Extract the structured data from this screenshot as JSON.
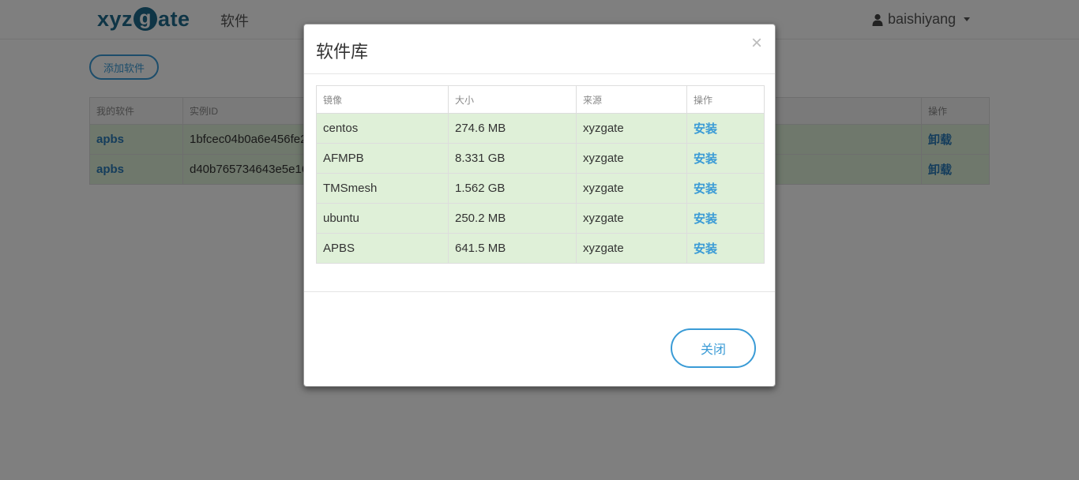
{
  "navbar": {
    "logo_prefix": "xyz",
    "logo_g": "g",
    "logo_suffix": "ate",
    "nav_link": "软件",
    "username": "baishiyang"
  },
  "page": {
    "add_button_label": "添加软件",
    "table": {
      "headers": [
        "我的软件",
        "实例ID",
        "操作"
      ],
      "rows": [
        {
          "name": "apbs",
          "instance_id": "1bfcec04b0a6e456fe2",
          "action": "卸载"
        },
        {
          "name": "apbs",
          "instance_id": "d40b765734643e5e16",
          "action": "卸载"
        }
      ]
    }
  },
  "modal": {
    "title": "软件库",
    "headers": {
      "image": "镜像",
      "size": "大小",
      "source": "来源",
      "action": "操作"
    },
    "rows": [
      {
        "image": "centos",
        "size": "274.6 MB",
        "source": "xyzgate",
        "action": "安装"
      },
      {
        "image": "AFMPB",
        "size": "8.331 GB",
        "source": "xyzgate",
        "action": "安装"
      },
      {
        "image": "TMSmesh",
        "size": "1.562 GB",
        "source": "xyzgate",
        "action": "安装"
      },
      {
        "image": "ubuntu",
        "size": "250.2 MB",
        "source": "xyzgate",
        "action": "安装"
      },
      {
        "image": "APBS",
        "size": "641.5 MB",
        "source": "xyzgate",
        "action": "安装"
      }
    ],
    "close_button_label": "关闭",
    "close_icon": "×"
  },
  "colors": {
    "brand": "#1e6a8d",
    "accent": "#3a9bd6",
    "row_success": "#dff0d8"
  }
}
